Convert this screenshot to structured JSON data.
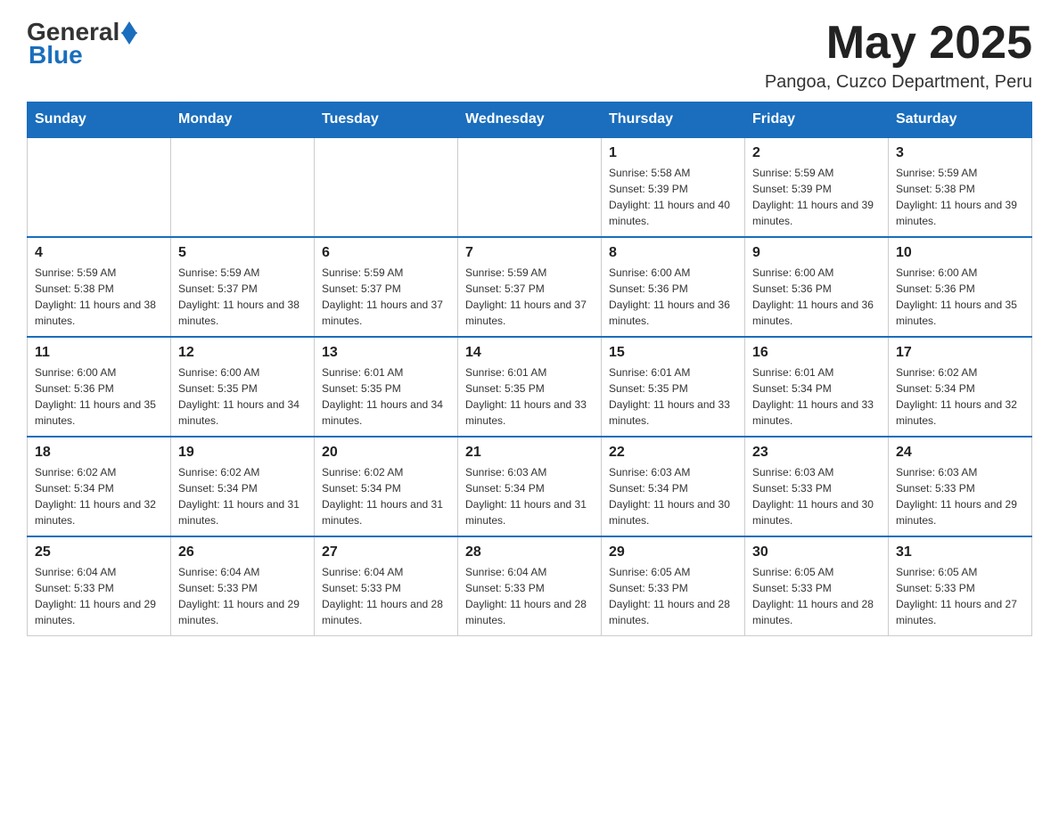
{
  "header": {
    "logo": {
      "general": "General",
      "blue": "Blue"
    },
    "title": "May 2025",
    "location": "Pangoa, Cuzco Department, Peru"
  },
  "days_of_week": [
    "Sunday",
    "Monday",
    "Tuesday",
    "Wednesday",
    "Thursday",
    "Friday",
    "Saturday"
  ],
  "weeks": [
    [
      {
        "day": "",
        "info": ""
      },
      {
        "day": "",
        "info": ""
      },
      {
        "day": "",
        "info": ""
      },
      {
        "day": "",
        "info": ""
      },
      {
        "day": "1",
        "info": "Sunrise: 5:58 AM\nSunset: 5:39 PM\nDaylight: 11 hours and 40 minutes."
      },
      {
        "day": "2",
        "info": "Sunrise: 5:59 AM\nSunset: 5:39 PM\nDaylight: 11 hours and 39 minutes."
      },
      {
        "day": "3",
        "info": "Sunrise: 5:59 AM\nSunset: 5:38 PM\nDaylight: 11 hours and 39 minutes."
      }
    ],
    [
      {
        "day": "4",
        "info": "Sunrise: 5:59 AM\nSunset: 5:38 PM\nDaylight: 11 hours and 38 minutes."
      },
      {
        "day": "5",
        "info": "Sunrise: 5:59 AM\nSunset: 5:37 PM\nDaylight: 11 hours and 38 minutes."
      },
      {
        "day": "6",
        "info": "Sunrise: 5:59 AM\nSunset: 5:37 PM\nDaylight: 11 hours and 37 minutes."
      },
      {
        "day": "7",
        "info": "Sunrise: 5:59 AM\nSunset: 5:37 PM\nDaylight: 11 hours and 37 minutes."
      },
      {
        "day": "8",
        "info": "Sunrise: 6:00 AM\nSunset: 5:36 PM\nDaylight: 11 hours and 36 minutes."
      },
      {
        "day": "9",
        "info": "Sunrise: 6:00 AM\nSunset: 5:36 PM\nDaylight: 11 hours and 36 minutes."
      },
      {
        "day": "10",
        "info": "Sunrise: 6:00 AM\nSunset: 5:36 PM\nDaylight: 11 hours and 35 minutes."
      }
    ],
    [
      {
        "day": "11",
        "info": "Sunrise: 6:00 AM\nSunset: 5:36 PM\nDaylight: 11 hours and 35 minutes."
      },
      {
        "day": "12",
        "info": "Sunrise: 6:00 AM\nSunset: 5:35 PM\nDaylight: 11 hours and 34 minutes."
      },
      {
        "day": "13",
        "info": "Sunrise: 6:01 AM\nSunset: 5:35 PM\nDaylight: 11 hours and 34 minutes."
      },
      {
        "day": "14",
        "info": "Sunrise: 6:01 AM\nSunset: 5:35 PM\nDaylight: 11 hours and 33 minutes."
      },
      {
        "day": "15",
        "info": "Sunrise: 6:01 AM\nSunset: 5:35 PM\nDaylight: 11 hours and 33 minutes."
      },
      {
        "day": "16",
        "info": "Sunrise: 6:01 AM\nSunset: 5:34 PM\nDaylight: 11 hours and 33 minutes."
      },
      {
        "day": "17",
        "info": "Sunrise: 6:02 AM\nSunset: 5:34 PM\nDaylight: 11 hours and 32 minutes."
      }
    ],
    [
      {
        "day": "18",
        "info": "Sunrise: 6:02 AM\nSunset: 5:34 PM\nDaylight: 11 hours and 32 minutes."
      },
      {
        "day": "19",
        "info": "Sunrise: 6:02 AM\nSunset: 5:34 PM\nDaylight: 11 hours and 31 minutes."
      },
      {
        "day": "20",
        "info": "Sunrise: 6:02 AM\nSunset: 5:34 PM\nDaylight: 11 hours and 31 minutes."
      },
      {
        "day": "21",
        "info": "Sunrise: 6:03 AM\nSunset: 5:34 PM\nDaylight: 11 hours and 31 minutes."
      },
      {
        "day": "22",
        "info": "Sunrise: 6:03 AM\nSunset: 5:34 PM\nDaylight: 11 hours and 30 minutes."
      },
      {
        "day": "23",
        "info": "Sunrise: 6:03 AM\nSunset: 5:33 PM\nDaylight: 11 hours and 30 minutes."
      },
      {
        "day": "24",
        "info": "Sunrise: 6:03 AM\nSunset: 5:33 PM\nDaylight: 11 hours and 29 minutes."
      }
    ],
    [
      {
        "day": "25",
        "info": "Sunrise: 6:04 AM\nSunset: 5:33 PM\nDaylight: 11 hours and 29 minutes."
      },
      {
        "day": "26",
        "info": "Sunrise: 6:04 AM\nSunset: 5:33 PM\nDaylight: 11 hours and 29 minutes."
      },
      {
        "day": "27",
        "info": "Sunrise: 6:04 AM\nSunset: 5:33 PM\nDaylight: 11 hours and 28 minutes."
      },
      {
        "day": "28",
        "info": "Sunrise: 6:04 AM\nSunset: 5:33 PM\nDaylight: 11 hours and 28 minutes."
      },
      {
        "day": "29",
        "info": "Sunrise: 6:05 AM\nSunset: 5:33 PM\nDaylight: 11 hours and 28 minutes."
      },
      {
        "day": "30",
        "info": "Sunrise: 6:05 AM\nSunset: 5:33 PM\nDaylight: 11 hours and 28 minutes."
      },
      {
        "day": "31",
        "info": "Sunrise: 6:05 AM\nSunset: 5:33 PM\nDaylight: 11 hours and 27 minutes."
      }
    ]
  ]
}
